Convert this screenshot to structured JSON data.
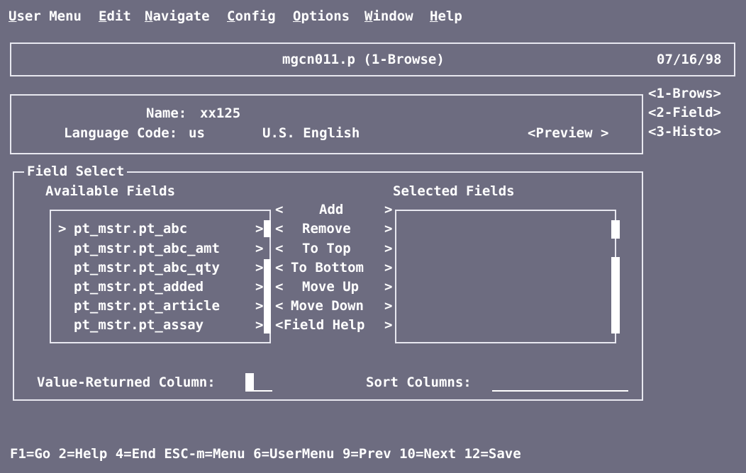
{
  "menu": [
    "User Menu",
    "Edit",
    "Navigate",
    "Config",
    "Options",
    "Window",
    "Help"
  ],
  "header": {
    "program": "mgcn011.p (1-Browse)",
    "date": "07/16/98"
  },
  "side_tabs": [
    "<1-Brows>",
    "<2-Field>",
    "<3-Histo>"
  ],
  "info": {
    "name_label": "Name:",
    "name_value": "xx125",
    "lang_label": "Language Code:",
    "lang_code": "us",
    "lang_desc": "U.S. English",
    "preview": "<Preview >"
  },
  "field_select": {
    "title": "Field Select",
    "available_title": "Available Fields",
    "selected_title": "Selected Fields",
    "available": [
      {
        "marker": ">",
        "name": "pt_mstr.pt_abc"
      },
      {
        "marker": "",
        "name": "pt_mstr.pt_abc_amt"
      },
      {
        "marker": "",
        "name": "pt_mstr.pt_abc_qty"
      },
      {
        "marker": "",
        "name": "pt_mstr.pt_added"
      },
      {
        "marker": "",
        "name": "pt_mstr.pt_article"
      },
      {
        "marker": "",
        "name": "pt_mstr.pt_assay"
      }
    ],
    "buttons": [
      "Add",
      "Remove",
      "To Top",
      "To Bottom",
      "Move Up",
      "Move Down",
      "Field Help"
    ],
    "value_col_label": "Value-Returned Column:",
    "sort_label": "Sort Columns:",
    "sort_value": ""
  },
  "footer": "F1=Go 2=Help 4=End ESC-m=Menu 6=UserMenu 9=Prev 10=Next 12=Save"
}
